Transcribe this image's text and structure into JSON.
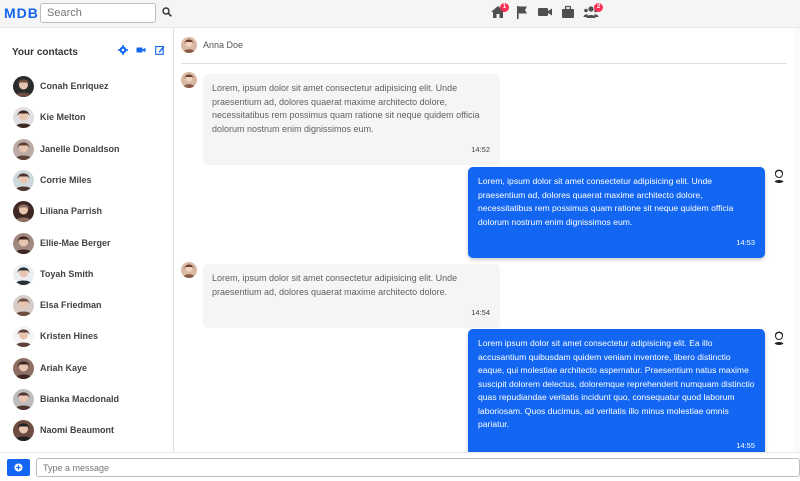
{
  "app": {
    "logo": "MDB"
  },
  "search": {
    "placeholder": "Search"
  },
  "nav": {
    "items": [
      {
        "icon": "home-icon",
        "badge": "1"
      },
      {
        "icon": "flag-icon",
        "badge": ""
      },
      {
        "icon": "video-icon",
        "badge": ""
      },
      {
        "icon": "briefcase-icon",
        "badge": ""
      },
      {
        "icon": "users-icon",
        "badge": "2"
      }
    ]
  },
  "sidebar": {
    "title": "Your contacts",
    "contacts": [
      {
        "name": "Conah Enriquez"
      },
      {
        "name": "Kie Melton"
      },
      {
        "name": "Janelle Donaldson"
      },
      {
        "name": "Corrie Miles"
      },
      {
        "name": "Liliana Parrish"
      },
      {
        "name": "Ellie-Mae Berger"
      },
      {
        "name": "Toyah Smith"
      },
      {
        "name": "Elsa Friedman"
      },
      {
        "name": "Kristen Hines"
      },
      {
        "name": "Ariah Kaye"
      },
      {
        "name": "Bianka Macdonald"
      },
      {
        "name": "Naomi Beaumont"
      }
    ]
  },
  "chat": {
    "contact_name": "Anna Doe",
    "messages": [
      {
        "side": "left",
        "text": "Lorem, ipsum dolor sit amet consectetur adipisicing elit. Unde praesentium ad, dolores quaerat maxime architecto dolore, necessitatibus rem possimus quam ratione sit neque quidem officia dolorum nostrum enim dignissimos eum.",
        "time": "14:52"
      },
      {
        "side": "right",
        "text": "Lorem, ipsum dolor sit amet consectetur adipisicing elit. Unde praesentium ad, dolores quaerat maxime architecto dolore, necessitatibus rem possimus quam ratione sit neque quidem officia dolorum nostrum enim dignissimos eum.",
        "time": "14:53"
      },
      {
        "side": "left",
        "text": "Lorem, ipsum dolor sit amet consectetur adipisicing elit. Unde praesentium ad, dolores quaerat maxime architecto dolore.",
        "time": "14:54"
      },
      {
        "side": "right",
        "text": "Lorem ipsum dolor sit amet consectetur adipisicing elit. Ea illo accusantium quibusdam quidem veniam inventore, libero distinctio eaque, qui molestiae architecto aspernatur. Praesentium natus maxime suscipit dolorem delectus, doloremque reprehenderit numquam distinctio quas repudiandae veritatis incidunt quo, consequatur quod laborum laboriosam. Quos ducimus, ad veritatis illo minus molestiae omnis pariatur.",
        "time": "14:55"
      }
    ]
  },
  "composer": {
    "placeholder": "Type a message"
  },
  "colors": {
    "accent": "#1266f1",
    "badge": "#f93154"
  }
}
